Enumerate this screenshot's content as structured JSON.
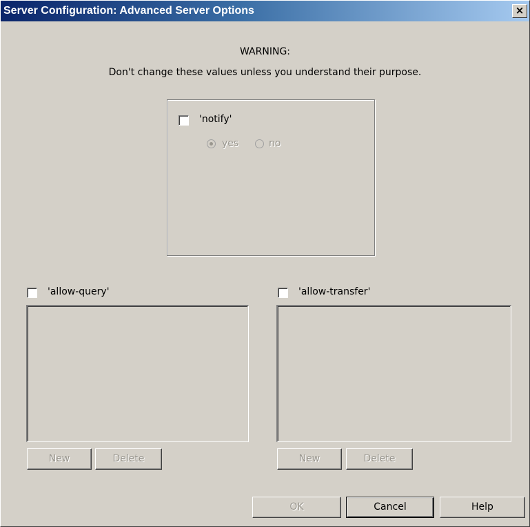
{
  "window": {
    "title": "Server Configuration: Advanced Server Options",
    "close_glyph": "×"
  },
  "warning": {
    "title": "WARNING:",
    "text": "Don't change these values unless you understand their purpose."
  },
  "notify": {
    "label": "'notify'",
    "checked": false,
    "options": [
      {
        "label": "yes",
        "selected": true
      },
      {
        "label": "no",
        "selected": false
      }
    ]
  },
  "allow_query": {
    "label": "'allow-query'",
    "checked": false,
    "items": [],
    "new_label": "New",
    "delete_label": "Delete"
  },
  "allow_transfer": {
    "label": "'allow-transfer'",
    "checked": false,
    "items": [],
    "new_label": "New",
    "delete_label": "Delete"
  },
  "footer": {
    "ok_label": "OK",
    "cancel_label": "Cancel",
    "help_label": "Help"
  }
}
